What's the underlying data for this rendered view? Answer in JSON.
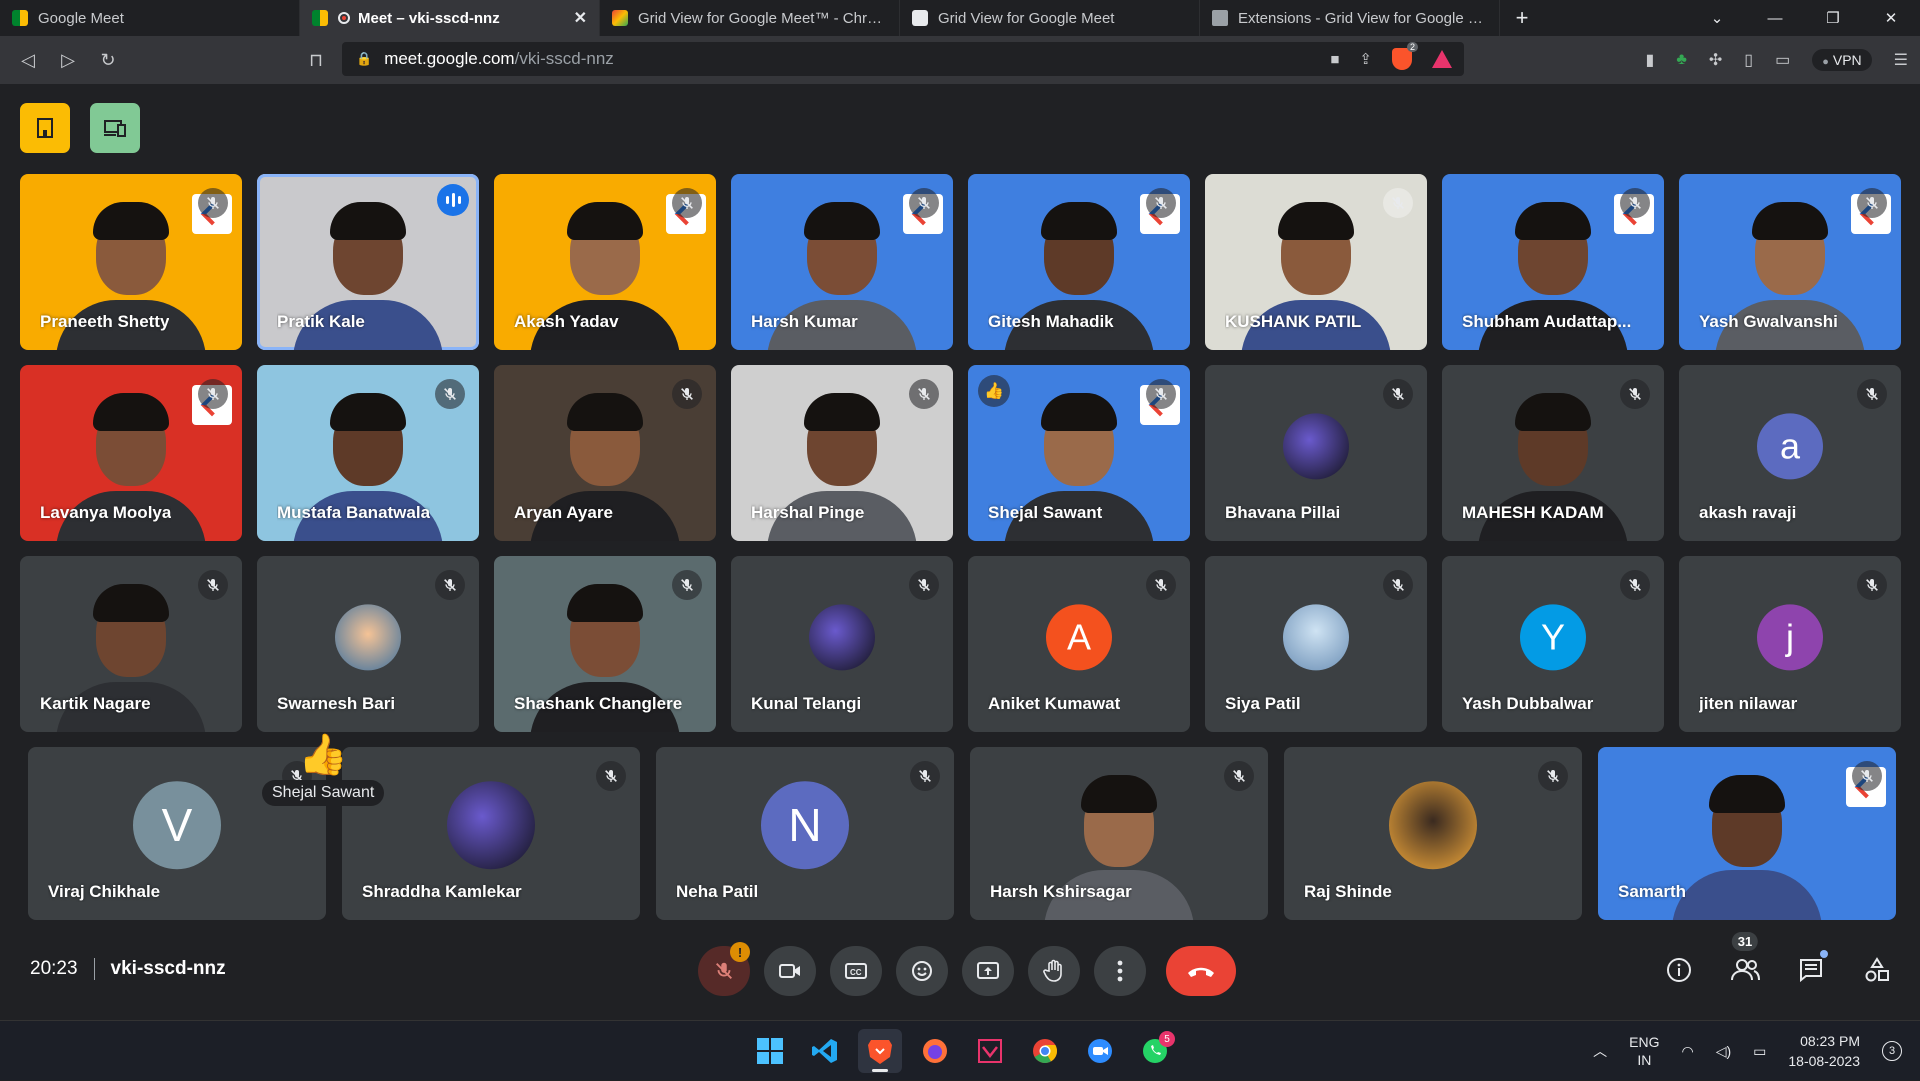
{
  "browser": {
    "tabs": [
      {
        "title": "Google Meet",
        "active": false
      },
      {
        "title": "Meet – vki-sscd-nnz",
        "active": true
      },
      {
        "title": "Grid View for Google Meet™ - Chrome",
        "active": false
      },
      {
        "title": "Grid View for Google Meet",
        "active": false
      },
      {
        "title": "Extensions - Grid View for Google Meet",
        "active": false
      }
    ],
    "url_host": "meet.google.com",
    "url_path": "/vki-sscd-nnz",
    "brave_badge": "2",
    "vpn_label": "VPN"
  },
  "participants": [
    {
      "name": "Praneeth Shetty",
      "state": "video",
      "bg": "#f9ab00"
    },
    {
      "name": "Pratik Kale",
      "state": "speaking",
      "bg": "#c9c9cc"
    },
    {
      "name": "Akash Yadav",
      "state": "video",
      "bg": "#f9ab00"
    },
    {
      "name": "Harsh Kumar",
      "state": "video",
      "bg": "#3f7fe0"
    },
    {
      "name": "Gitesh Mahadik",
      "state": "video",
      "bg": "#3f7fe0"
    },
    {
      "name": "KUSHANK PATIL",
      "state": "video",
      "bg": "#dcdcd4"
    },
    {
      "name": "Shubham Audattap...",
      "state": "video",
      "bg": "#3f7fe0"
    },
    {
      "name": "Yash Gwalvanshi",
      "state": "video",
      "bg": "#3f7fe0"
    },
    {
      "name": "Lavanya Moolya",
      "state": "video",
      "bg": "#d93025"
    },
    {
      "name": "Mustafa Banatwala",
      "state": "video",
      "bg": "#8ec5e0"
    },
    {
      "name": "Aryan Ayare",
      "state": "video",
      "bg": "#4a3e35"
    },
    {
      "name": "Harshal Pinge",
      "state": "video",
      "bg": "#cfcfcf"
    },
    {
      "name": "Shejal Sawant",
      "state": "video",
      "bg": "#3f7fe0"
    },
    {
      "name": "Bhavana Pillai",
      "state": "photo",
      "bg": "#3c4043"
    },
    {
      "name": "MAHESH KADAM",
      "state": "video",
      "bg": "#3c4043"
    },
    {
      "name": "akash ravaji",
      "state": "letter",
      "letter": "a",
      "color": "#5c6bc0",
      "bg": "#3c4043"
    },
    {
      "name": "Kartik Nagare",
      "state": "video",
      "bg": "#3c4043"
    },
    {
      "name": "Swarnesh Bari",
      "state": "photo",
      "bg": "#3c4043"
    },
    {
      "name": "Shashank Changlere",
      "state": "video",
      "bg": "#5b6b6e"
    },
    {
      "name": "Kunal Telangi",
      "state": "photo",
      "bg": "#3c4043"
    },
    {
      "name": "Aniket Kumawat",
      "state": "letter",
      "letter": "A",
      "color": "#f4511e",
      "bg": "#3c4043"
    },
    {
      "name": "Siya Patil",
      "state": "photo",
      "bg": "#3c4043"
    },
    {
      "name": "Yash Dubbalwar",
      "state": "letter",
      "letter": "Y",
      "color": "#039be5",
      "bg": "#3c4043"
    },
    {
      "name": "jiten nilawar",
      "state": "letter",
      "letter": "j",
      "color": "#8e44ad",
      "bg": "#3c4043"
    },
    {
      "name": "Viraj Chikhale",
      "state": "letter",
      "letter": "V",
      "color": "#78909c",
      "bg": "#3c4043"
    },
    {
      "name": "Shraddha Kamlekar",
      "state": "photo",
      "bg": "#3c4043"
    },
    {
      "name": "Neha Patil",
      "state": "letter",
      "letter": "N",
      "color": "#5c6bc0",
      "bg": "#3c4043"
    },
    {
      "name": "Harsh Kshirsagar",
      "state": "video",
      "bg": "#3c4043"
    },
    {
      "name": "Raj Shinde",
      "state": "photo",
      "bg": "#3c4043"
    },
    {
      "name": "Samarth",
      "state": "video",
      "bg": "#3f7fe0"
    }
  ],
  "reaction": {
    "emoji": "👍",
    "by": "Shejal Sawant"
  },
  "meeting": {
    "time": "20:23",
    "code": "vki-sscd-nnz",
    "participant_count": "31"
  },
  "taskbar": {
    "lang_top": "ENG",
    "lang_bottom": "IN",
    "time": "08:23 PM",
    "date": "18-08-2023",
    "notif_count": "3",
    "whatsapp_badge": "5"
  }
}
